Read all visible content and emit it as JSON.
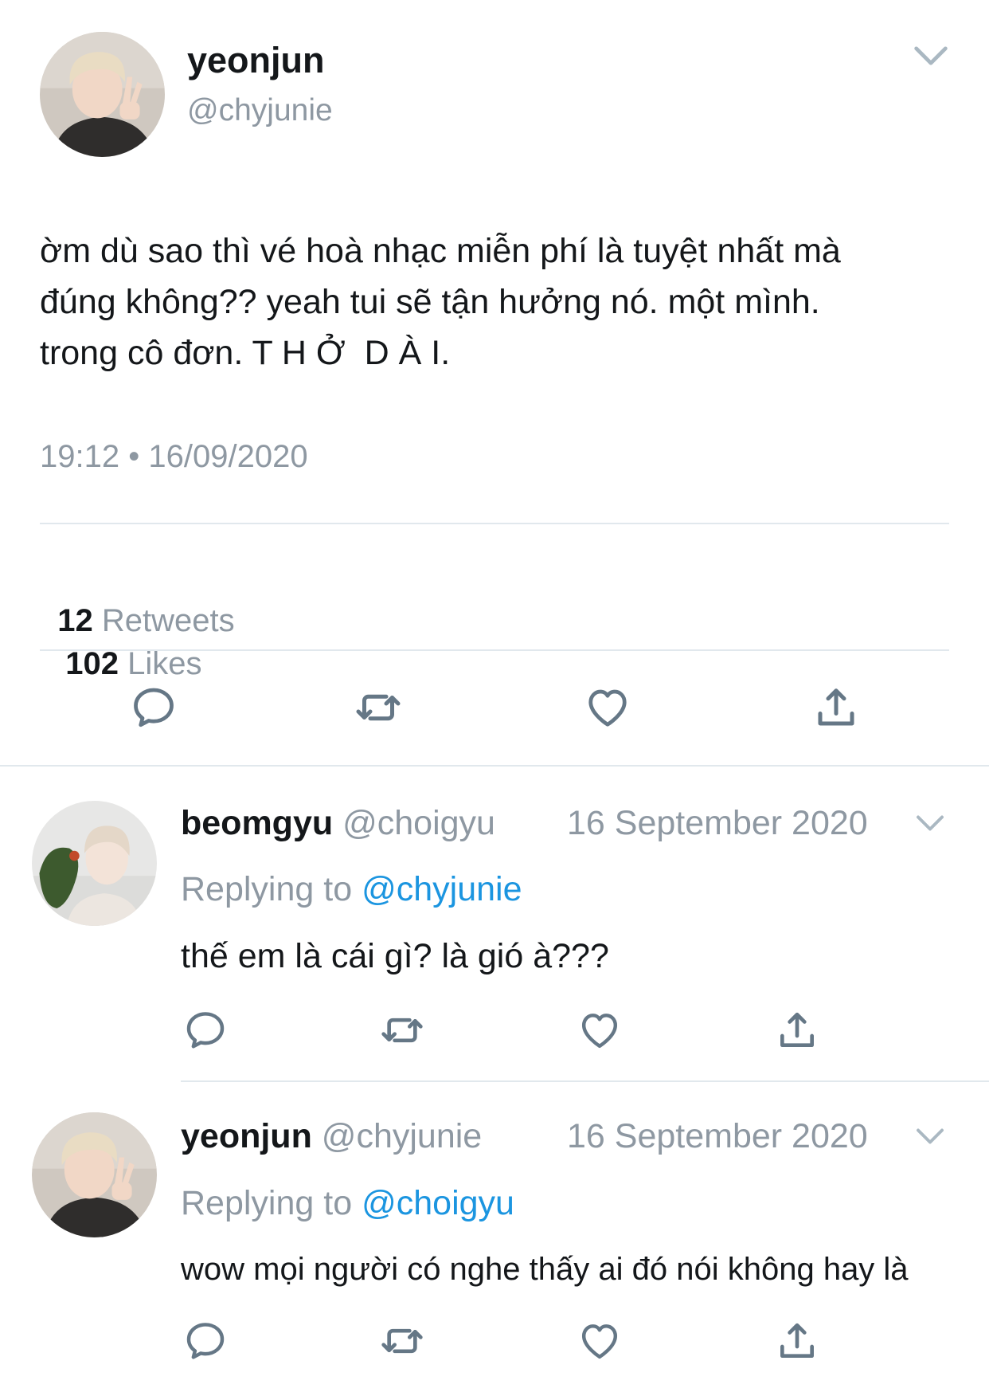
{
  "main_tweet": {
    "display_name": "yeonjun",
    "handle": "@chyjunie",
    "text_lines": [
      "ờm dù sao thì vé hoà nhạc miễn phí là tuyệt nhất mà",
      "đúng không?? yeah tui sẽ tận hưởng nó. một mình.",
      "trong cô đơn. T H Ở  D À I."
    ],
    "time": "19:12",
    "separator": "•",
    "date": "16/09/2020",
    "retweets_count": "12",
    "retweets_label": "Retweets",
    "likes_count": "102",
    "likes_label": "Likes"
  },
  "replies": [
    {
      "display_name": "beomgyu",
      "handle": "@choigyu",
      "date": "16 September 2020",
      "replying_label": "Replying to",
      "replying_to": "@chyjunie",
      "text": "thế em là cái gì? là gió à???"
    },
    {
      "display_name": "yeonjun",
      "handle": "@chyjunie",
      "date": "16 September 2020",
      "replying_label": "Replying to",
      "replying_to": "@choigyu",
      "text": "wow mọi người có nghe thấy ai đó nói không hay là"
    }
  ],
  "colors": {
    "gray_text": "#8e98a2",
    "link_blue": "#1b95e0",
    "icon_gray": "#657786",
    "divider": "#e1e8ed"
  },
  "icons": [
    "chevron-down-icon",
    "reply-icon",
    "retweet-icon",
    "like-icon",
    "share-icon"
  ]
}
